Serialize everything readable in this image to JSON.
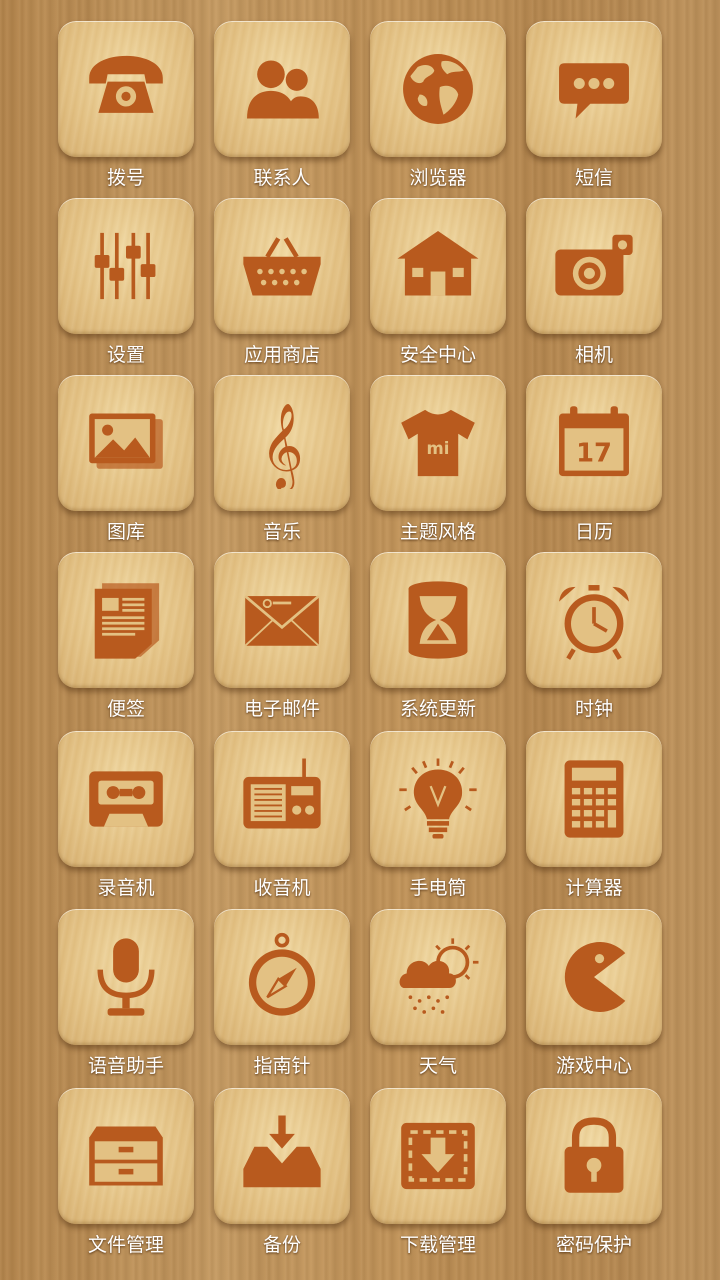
{
  "apps": [
    {
      "label": "拨号",
      "icon": "phone-icon"
    },
    {
      "label": "联系人",
      "icon": "contacts-icon"
    },
    {
      "label": "浏览器",
      "icon": "globe-icon"
    },
    {
      "label": "短信",
      "icon": "message-icon"
    },
    {
      "label": "设置",
      "icon": "sliders-icon"
    },
    {
      "label": "应用商店",
      "icon": "basket-icon"
    },
    {
      "label": "安全中心",
      "icon": "house-icon"
    },
    {
      "label": "相机",
      "icon": "camera-icon"
    },
    {
      "label": "图库",
      "icon": "gallery-icon"
    },
    {
      "label": "音乐",
      "icon": "treble-clef-icon"
    },
    {
      "label": "主题风格",
      "icon": "tshirt-icon"
    },
    {
      "label": "日历",
      "icon": "calendar-icon",
      "text": "17"
    },
    {
      "label": "便签",
      "icon": "notes-icon"
    },
    {
      "label": "电子邮件",
      "icon": "envelope-icon"
    },
    {
      "label": "系统更新",
      "icon": "hourglass-icon"
    },
    {
      "label": "时钟",
      "icon": "alarm-clock-icon"
    },
    {
      "label": "录音机",
      "icon": "cassette-icon"
    },
    {
      "label": "收音机",
      "icon": "radio-icon"
    },
    {
      "label": "手电筒",
      "icon": "lightbulb-icon"
    },
    {
      "label": "计算器",
      "icon": "calculator-icon"
    },
    {
      "label": "语音助手",
      "icon": "microphone-icon"
    },
    {
      "label": "指南针",
      "icon": "compass-icon"
    },
    {
      "label": "天气",
      "icon": "weather-icon"
    },
    {
      "label": "游戏中心",
      "icon": "pacman-icon"
    },
    {
      "label": "文件管理",
      "icon": "file-drawer-icon"
    },
    {
      "label": "备份",
      "icon": "backup-inbox-icon"
    },
    {
      "label": "下载管理",
      "icon": "download-icon"
    },
    {
      "label": "密码保护",
      "icon": "padlock-icon"
    }
  ],
  "theme": {
    "icon_color": "#b85a1e",
    "tile_color": "#e8c88a",
    "label_color": "#ffffff"
  }
}
